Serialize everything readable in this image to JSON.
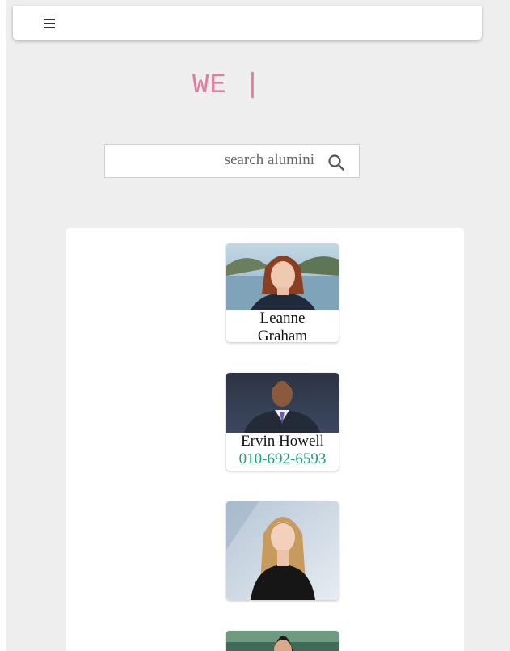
{
  "header": {
    "menu_icon": "hamburger-menu-icon"
  },
  "brand": {
    "text": "WE",
    "cursor": "|"
  },
  "search": {
    "placeholder": "search alumini",
    "icon": "search-icon"
  },
  "alumni": [
    {
      "name_line1": "Leanne",
      "name_line2": "Graham",
      "phone": ""
    },
    {
      "name": "Ervin Howell",
      "phone": "010-692-6593"
    },
    {
      "name": "",
      "phone": ""
    },
    {
      "name": "",
      "phone": ""
    }
  ],
  "colors": {
    "brand": "#e57aa0",
    "phone": "#1aa37a",
    "background": "#eeeeee"
  }
}
